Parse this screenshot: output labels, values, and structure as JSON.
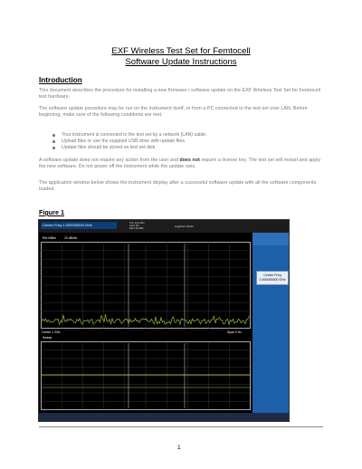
{
  "document": {
    "title_line1": "EXF Wireless Test Set for Femtocell",
    "title_line2": "Software Update Instructions",
    "intro_heading": "Introduction",
    "para1": "This document describes the procedure for installing a new firmware / software update on the EXF Wireless Test Set for Femtocell test hardware.",
    "para2": "The software update procedure may be run on the instrument itself, or from a PC connected to the test set over LAN. Before beginning, make sure of the following conditions are met:",
    "bullets": [
      "Your instrument is connected to the test set by a network (LAN) cable.",
      "Upload files or use the supplied USB drive with update files.",
      "Update files should be stored on test set disk."
    ],
    "para3_before": "A software update does not require any action from the user and ",
    "para3_bold": "does not",
    "para3_after": " require a license key. The test set will restart and apply the new software. Do not power off the instrument while the update runs.",
    "para4": "The application window below shows the instrument display after a successful software update with all the software components loaded.",
    "figure_label": "Figure 1",
    "page_number": "1"
  },
  "screenshot": {
    "center_freq_box": "Center Freq 1.000000000 GHz",
    "status_lines": [
      "Trig: Free Run",
      "Input: RF",
      "Ref 0.00 dBm"
    ],
    "right_status": "Avg|Hold:>10/100",
    "cf_button_line1": "Center Freq",
    "cf_button_line2": "1.000000000 GHz",
    "upper_pane_title": "Ref 0dBm",
    "upper_pane_subtitle": "10 dB/div",
    "center_label": "Center 1 GHz",
    "span_label": "Span 0 Hz",
    "lower_pane_title": "Sweep"
  },
  "colors": {
    "screen_bg": "#000000",
    "panel_blue": "#1d5fa8",
    "trace_green": "#9cd43a",
    "trace_yellow": "#e8d34a",
    "grid": "#6a6a6a"
  }
}
